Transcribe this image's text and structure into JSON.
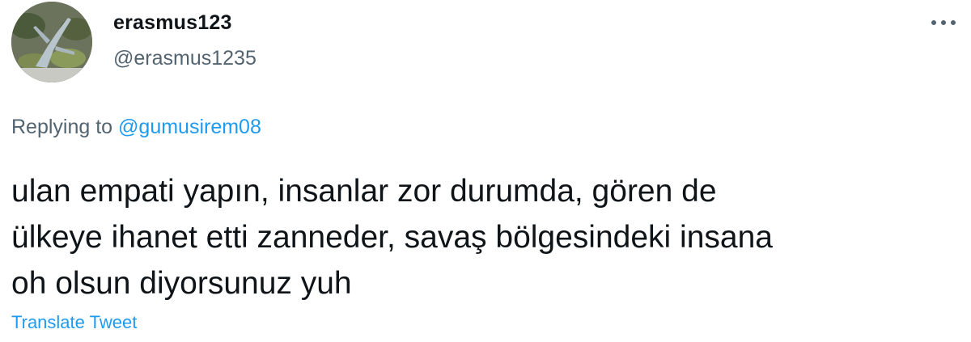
{
  "tweet": {
    "display_name": "erasmus123",
    "handle": "@erasmus1235",
    "reply_prefix": "Replying to",
    "reply_to": "@gumusirem08",
    "lines": [
      "ulan empati yapın, insanlar zor durumda, gören de",
      "ülkeye ihanet etti zanneder, savaş bölgesindeki insana",
      "oh olsun diyorsunuz yuh"
    ],
    "translate_label": "Translate Tweet"
  },
  "icons": {
    "more": "more-horizontal-icon",
    "avatar": "statue-photo"
  },
  "colors": {
    "text": "#0f1419",
    "secondary": "#536471",
    "link": "#1d9bf0"
  }
}
